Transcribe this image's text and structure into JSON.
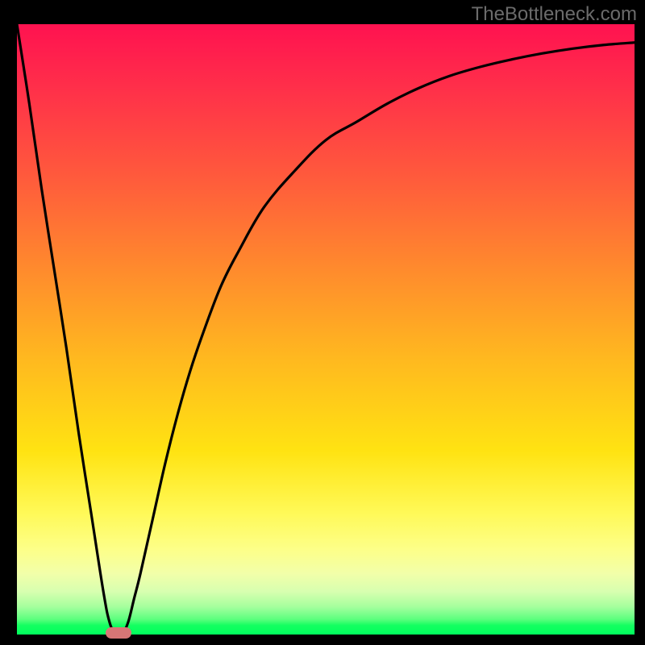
{
  "watermark": "TheBottleneck.com",
  "chart_data": {
    "type": "line",
    "title": "",
    "xlabel": "",
    "ylabel": "",
    "xlim": [
      0,
      100
    ],
    "ylim": [
      0,
      100
    ],
    "grid": false,
    "legend": false,
    "series": [
      {
        "name": "bottleneck-curve",
        "x": [
          0,
          2,
          4,
          6,
          8,
          10,
          12,
          14,
          15,
          16,
          17,
          18,
          19,
          20,
          22,
          24,
          26,
          28,
          30,
          33,
          36,
          40,
          45,
          50,
          55,
          60,
          65,
          70,
          75,
          80,
          85,
          90,
          95,
          100
        ],
        "y": [
          100,
          87,
          73,
          60,
          47,
          33,
          20,
          7,
          2,
          0,
          0,
          2,
          6,
          10,
          19,
          28,
          36,
          43,
          49,
          57,
          63,
          70,
          76,
          81,
          84,
          87,
          89.5,
          91.5,
          93,
          94.2,
          95.2,
          96,
          96.6,
          97
        ]
      }
    ],
    "marker": {
      "name": "minimum-pill",
      "x": 16.5,
      "y": 0
    },
    "colors": {
      "curve": "#000000",
      "marker": "#d77676",
      "gradient_top": "#ff1250",
      "gradient_bottom": "#00ff5d"
    }
  }
}
